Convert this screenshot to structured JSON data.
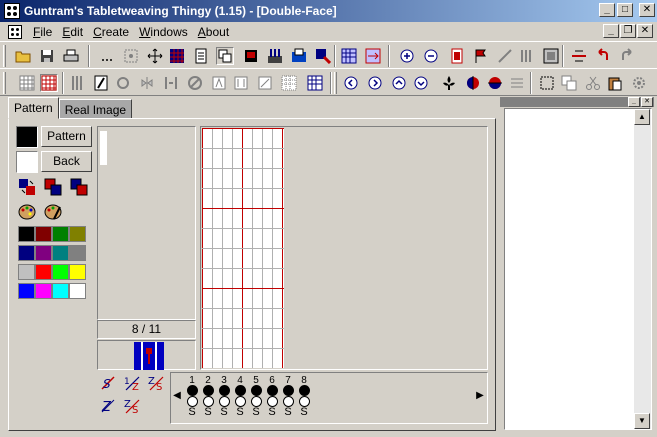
{
  "window": {
    "title": "Guntram's Tabletweaving Thingy (1.15) - [Double-Face]"
  },
  "menu": {
    "items": [
      {
        "label": "File",
        "accel": "F",
        "rest": "ile"
      },
      {
        "label": "Edit",
        "accel": "E",
        "rest": "dit"
      },
      {
        "label": "Create",
        "accel": "C",
        "rest": "reate"
      },
      {
        "label": "Windows",
        "accel": "W",
        "rest": "indows"
      },
      {
        "label": "About",
        "accel": "A",
        "rest": "bout"
      }
    ]
  },
  "tabs": [
    {
      "label": "Pattern",
      "active": true
    },
    {
      "label": "Real Image",
      "active": false
    }
  ],
  "pattern_panel": {
    "pattern_button": "Pattern",
    "back_button": "Back",
    "pattern_color": "#000000",
    "back_color": "#ffffff",
    "palette": [
      "#000000",
      "#800000",
      "#008000",
      "#808000",
      "#000080",
      "#800080",
      "#008080",
      "#808080",
      "#c0c0c0",
      "#ff0000",
      "#00ff00",
      "#ffff00",
      "#0000ff",
      "#ff00ff",
      "#00ffff",
      "#ffffff"
    ],
    "position_label": "8 / 11"
  },
  "cards": {
    "numbers": [
      "1",
      "2",
      "3",
      "4",
      "5",
      "6",
      "7",
      "8"
    ],
    "threading": [
      "S",
      "S",
      "S",
      "S",
      "S",
      "S",
      "S",
      "S"
    ]
  },
  "colors": {
    "accent_red": "#c00000",
    "grid_line": "#b0b0b0",
    "grid_major": "#c00000",
    "title_start": "#0a246a",
    "title_end": "#a6caf0"
  }
}
